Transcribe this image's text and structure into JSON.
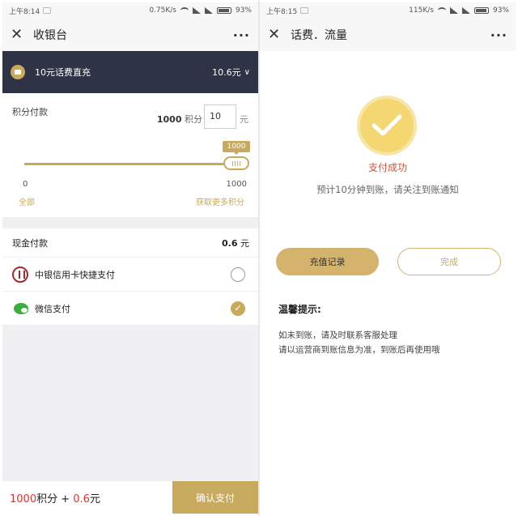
{
  "left": {
    "status": {
      "time": "上午8:14",
      "speed": "0.75K/s",
      "battery": "93%"
    },
    "titlebar": {
      "close_icon": "close-icon",
      "title": "收银台",
      "more": "···"
    },
    "product": {
      "icon": "phone-card-icon",
      "name": "10元话费直充",
      "price": "10.6元",
      "chevron": "∨"
    },
    "points": {
      "label": "积分付款",
      "points_value": "1000",
      "points_unit": "积分",
      "amount_input": "10",
      "amount_unit": "元",
      "slider_min": "0",
      "slider_max": "1000",
      "slider_value": "1000",
      "slider_fraction": 1.0,
      "all_link": "全部",
      "more_link": "获取更多积分"
    },
    "cash": {
      "label": "现金付款",
      "amount": "0.6",
      "unit": "元"
    },
    "methods": [
      {
        "label": "中银信用卡快捷支付",
        "icon": "boc-icon",
        "selected": false
      },
      {
        "label": "微信支付",
        "icon": "wechat-icon",
        "selected": true
      }
    ],
    "bottom": {
      "points": "1000",
      "points_unit": "积分",
      "plus": " + ",
      "cash": "0.6",
      "cash_unit": "元",
      "confirm": "确认支付"
    }
  },
  "right": {
    "status": {
      "time": "上午8:15",
      "speed": "115K/s",
      "battery": "93%"
    },
    "titlebar": {
      "close_icon": "close-icon",
      "title": "话费．流量",
      "more": "···"
    },
    "success": {
      "icon": "check-icon",
      "title": "支付成功",
      "desc": "预计10分钟到账，请关注到账通知"
    },
    "buttons": {
      "records": "充值记录",
      "done": "完成"
    },
    "tips": {
      "title": "温馨提示:",
      "lines": [
        "如未到账，请及时联系客服处理",
        "请以运营商到账信息为准，到账后再使用哦"
      ]
    }
  },
  "colors": {
    "gold": "#c8aa5f",
    "dark": "#2e3445",
    "red": "#d9352a",
    "success_yellow": "#f4d770"
  }
}
